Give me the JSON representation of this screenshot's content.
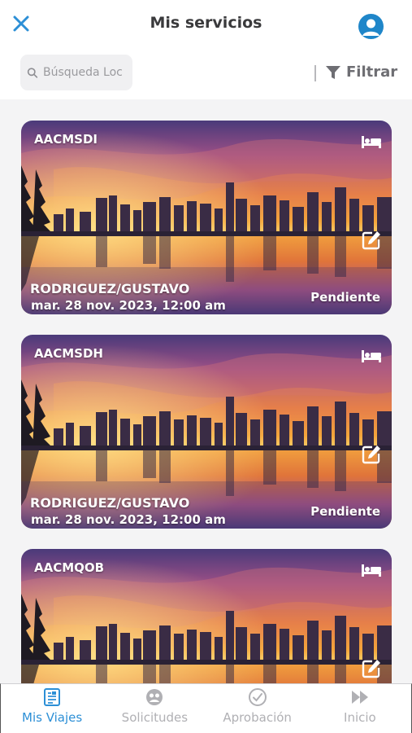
{
  "header": {
    "title": "Mis servicios",
    "close_icon": "close-icon",
    "profile_icon": "user-avatar-icon"
  },
  "search": {
    "placeholder": "Búsqueda Loc",
    "value": ""
  },
  "filter": {
    "label": "Filtrar",
    "icon": "funnel-icon"
  },
  "cards": [
    {
      "code": "AACMSDI",
      "name": "RODRIGUEZ/GUSTAVO",
      "date": "mar. 28 nov. 2023, 12:00 am",
      "status": "Pendiente"
    },
    {
      "code": "AACMSDH",
      "name": "RODRIGUEZ/GUSTAVO",
      "date": "mar. 28 nov. 2023, 12:00 am",
      "status": "Pendiente"
    },
    {
      "code": "AACMQOB",
      "name": "",
      "date": "",
      "status": ""
    }
  ],
  "nav": {
    "items": [
      {
        "label": "Mis Viajes",
        "icon": "document-icon",
        "active": true
      },
      {
        "label": "Solicitudes",
        "icon": "requests-icon",
        "active": false
      },
      {
        "label": "Aprobación",
        "icon": "approval-icon",
        "active": false
      },
      {
        "label": "Inicio",
        "icon": "fast-forward-icon",
        "active": false
      }
    ]
  },
  "colors": {
    "accent": "#2c8fd6",
    "profile": "#1f86c9",
    "inactive": "#b0b0b4",
    "title": "#3a3a3c"
  }
}
